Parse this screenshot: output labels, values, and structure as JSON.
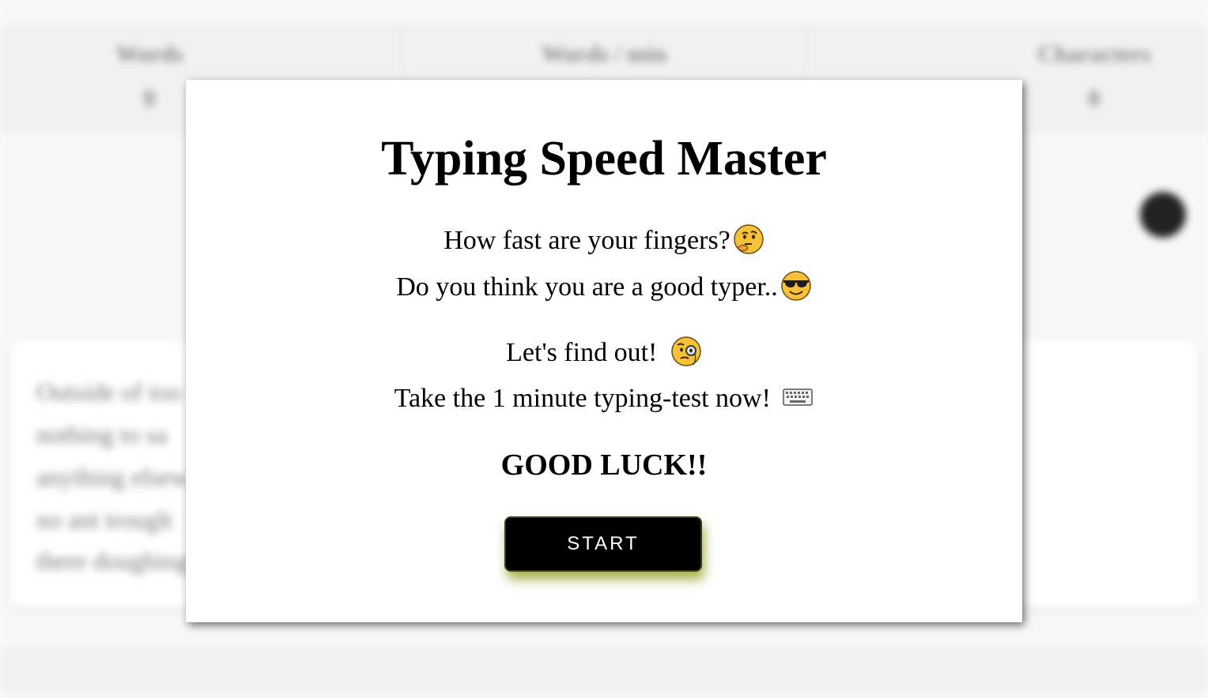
{
  "background": {
    "stats": [
      {
        "label": "Words",
        "value": "0"
      },
      {
        "label": "Words / min",
        "value": ""
      },
      {
        "label": "Characters",
        "value": "0"
      }
    ],
    "text_lines": [
      "Outside of too",
      "nothing to sa",
      "anything elsew",
      "no ant trouglt",
      "there doughing"
    ]
  },
  "modal": {
    "title": "Typing Speed Master",
    "line1": "How fast are your fingers?",
    "line2": "Do you think you are a good typer..",
    "line3": "Let's find out!",
    "line4": "Take the 1 minute typing-test now!",
    "good_luck": "GOOD LUCK!!",
    "start_label": "START",
    "icons": [
      "thinking-face-icon",
      "sunglasses-face-icon",
      "monocle-face-icon",
      "keyboard-icon"
    ]
  },
  "colors": {
    "button_bg": "#000000",
    "button_glow": "#8c9614",
    "modal_bg": "#ffffff"
  }
}
